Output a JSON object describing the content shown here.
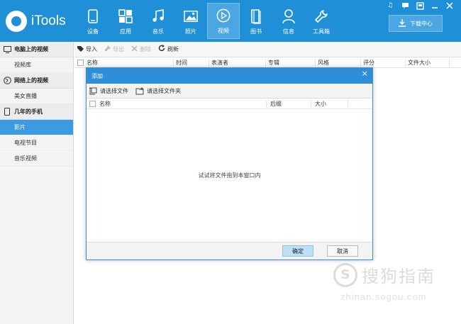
{
  "app": {
    "logo_text": "iTools",
    "accent_color": "#1f8fd8"
  },
  "nav": {
    "items": [
      {
        "label": "设备",
        "icon": "phone-icon"
      },
      {
        "label": "应用",
        "icon": "apps-icon"
      },
      {
        "label": "音乐",
        "icon": "music-icon"
      },
      {
        "label": "照片",
        "icon": "photo-icon"
      },
      {
        "label": "视频",
        "icon": "play-icon",
        "active": true
      },
      {
        "label": "图书",
        "icon": "book-icon"
      },
      {
        "label": "信息",
        "icon": "user-icon"
      },
      {
        "label": "工具箱",
        "icon": "wrench-icon"
      }
    ],
    "download_label": "下载中心"
  },
  "sidebar": {
    "sections": [
      {
        "title": "电脑上的视频",
        "icon": "monitor-icon",
        "items": [
          "视频库"
        ]
      },
      {
        "title": "网络上的视频",
        "icon": "globe-icon",
        "items": [
          "美女直播"
        ]
      },
      {
        "title": "几年的手机",
        "icon": "phone-icon",
        "items": [
          "影片",
          "电视节目",
          "音乐视频"
        ]
      }
    ],
    "active_item": "影片"
  },
  "toolbar": {
    "import": "导入",
    "export": "导出",
    "delete": "删除",
    "refresh": "刷新"
  },
  "columns": {
    "name": "名称",
    "time": "时间",
    "artist": "表演者",
    "album": "专辑",
    "style": "风格",
    "rating": "评分",
    "size": "文件大小"
  },
  "dialog": {
    "title": "添加",
    "close": "×",
    "select_file": "请选择文件",
    "select_folder": "请选择文件夹",
    "col_name": "名称",
    "col_ext": "后缀",
    "col_size": "大小",
    "hint": "试试将文件拖到本窗口内",
    "ok": "确定",
    "cancel": "取消"
  },
  "watermark": {
    "text": "搜狗指南",
    "url": "zhinan.sogou.com"
  }
}
